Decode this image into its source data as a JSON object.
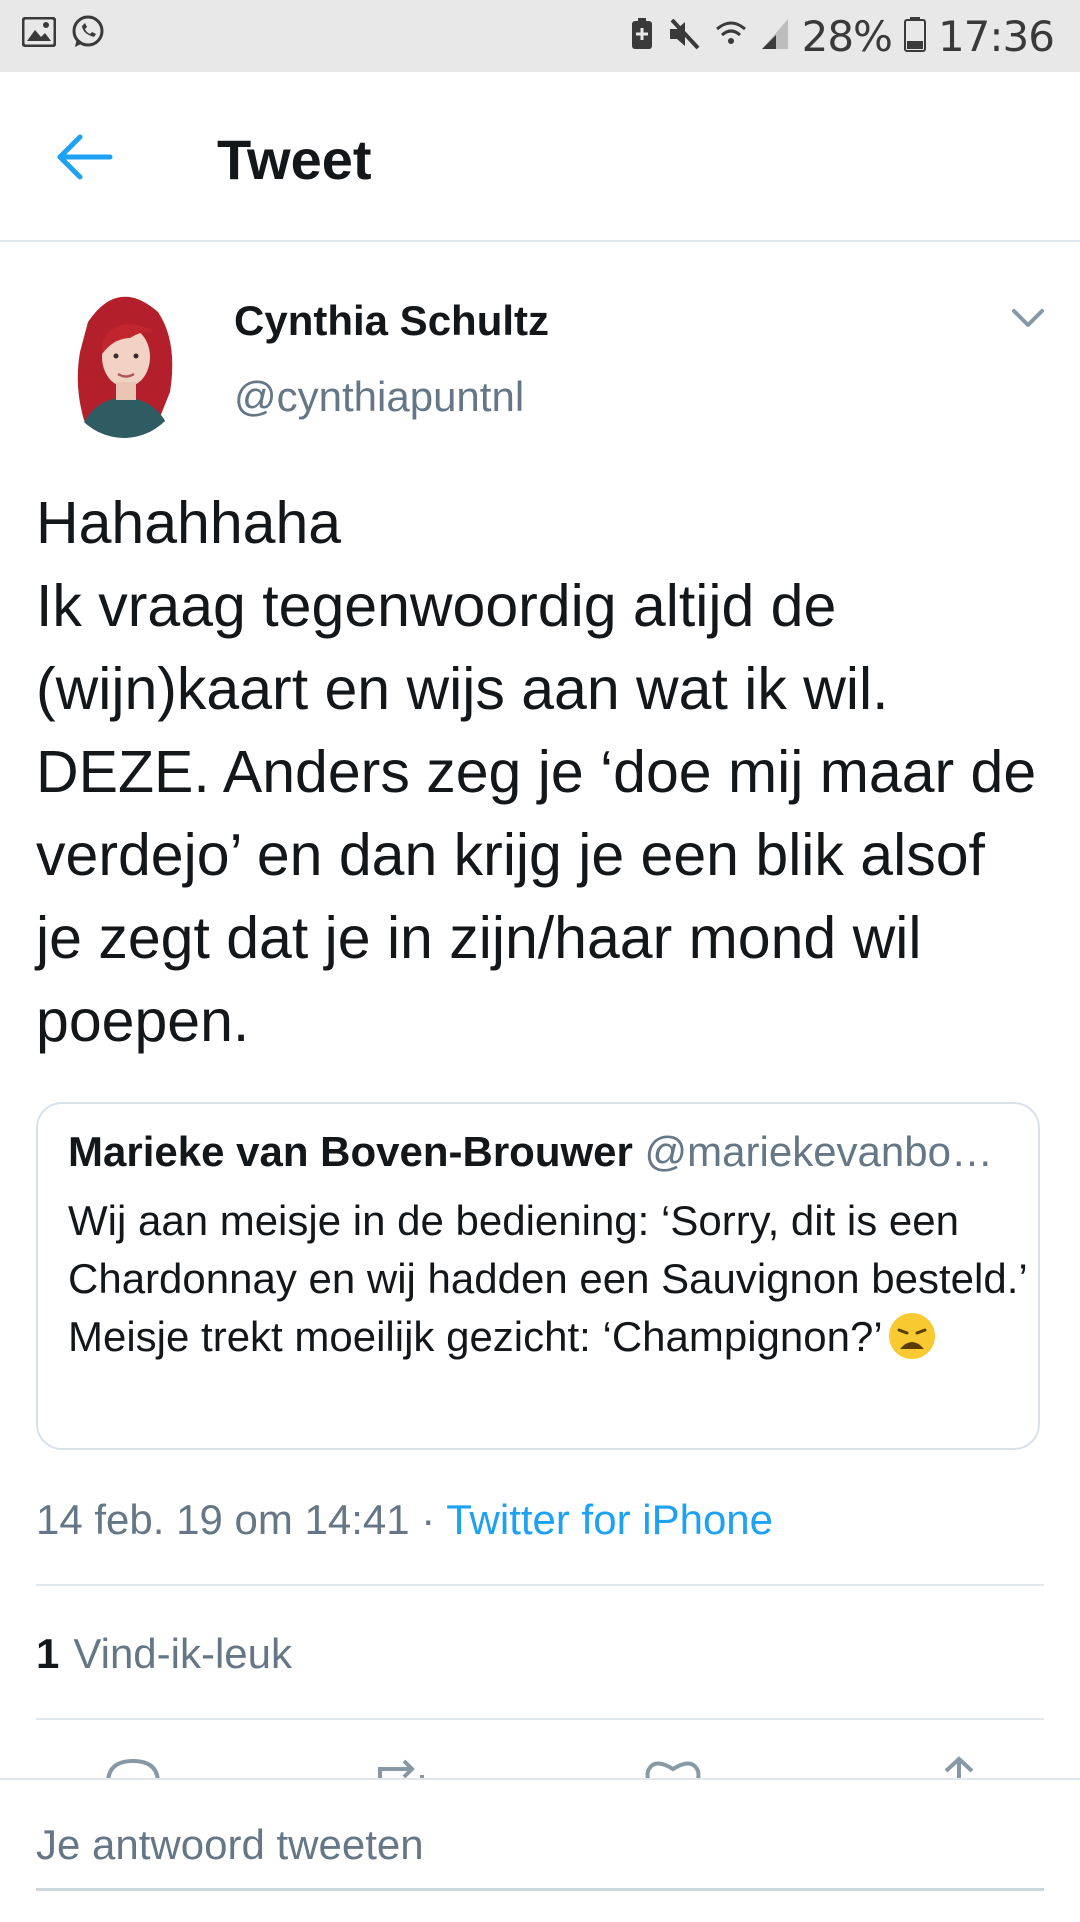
{
  "status_bar": {
    "battery": "28%",
    "time": "17:36",
    "left_icons": [
      "gallery-icon",
      "whatsapp-icon"
    ],
    "right_icons": [
      "battery-saver-icon",
      "mute-icon",
      "wifi-icon",
      "signal-icon",
      "battery-icon"
    ]
  },
  "header": {
    "title": "Tweet",
    "back_icon": "back-arrow-icon"
  },
  "tweet": {
    "author_name": "Cynthia Schultz",
    "author_handle": "@cynthiapuntnl",
    "text": "Hahahhaha\nIk vraag tegenwoordig altijd de (wijn)kaart en wijs aan wat ik wil. DEZE. Anders zeg je ‘doe mij maar de verdejo’ en dan krijg je een blik alsof je zegt dat je in zijn/haar mond wil poepen.",
    "timestamp": "14 feb. 19 om 14:41",
    "separator": " · ",
    "source": "Twitter for iPhone",
    "likes_count": "1",
    "likes_label": "Vind-ik-leuk"
  },
  "quoted_tweet": {
    "author_name": "Marieke van Boven-Brouwer",
    "author_handle": "@mariekevanbo…",
    "text": "Wij aan meisje in de bediening: ‘Sorry, dit is een Chardonnay en wij hadden een Sauvignon besteld.’ Meisje trekt moeilijk gezicht: ‘Champignon?’",
    "emoji": "weary-face-emoji"
  },
  "actions": [
    "reply-icon",
    "retweet-icon",
    "like-icon",
    "share-icon"
  ],
  "reply": {
    "placeholder": "Je antwoord tweeten"
  },
  "colors": {
    "accent": "#1da1f2",
    "secondary_text": "#657786",
    "border": "#e1e8ed",
    "status_bar_bg": "#e8e8e8"
  }
}
